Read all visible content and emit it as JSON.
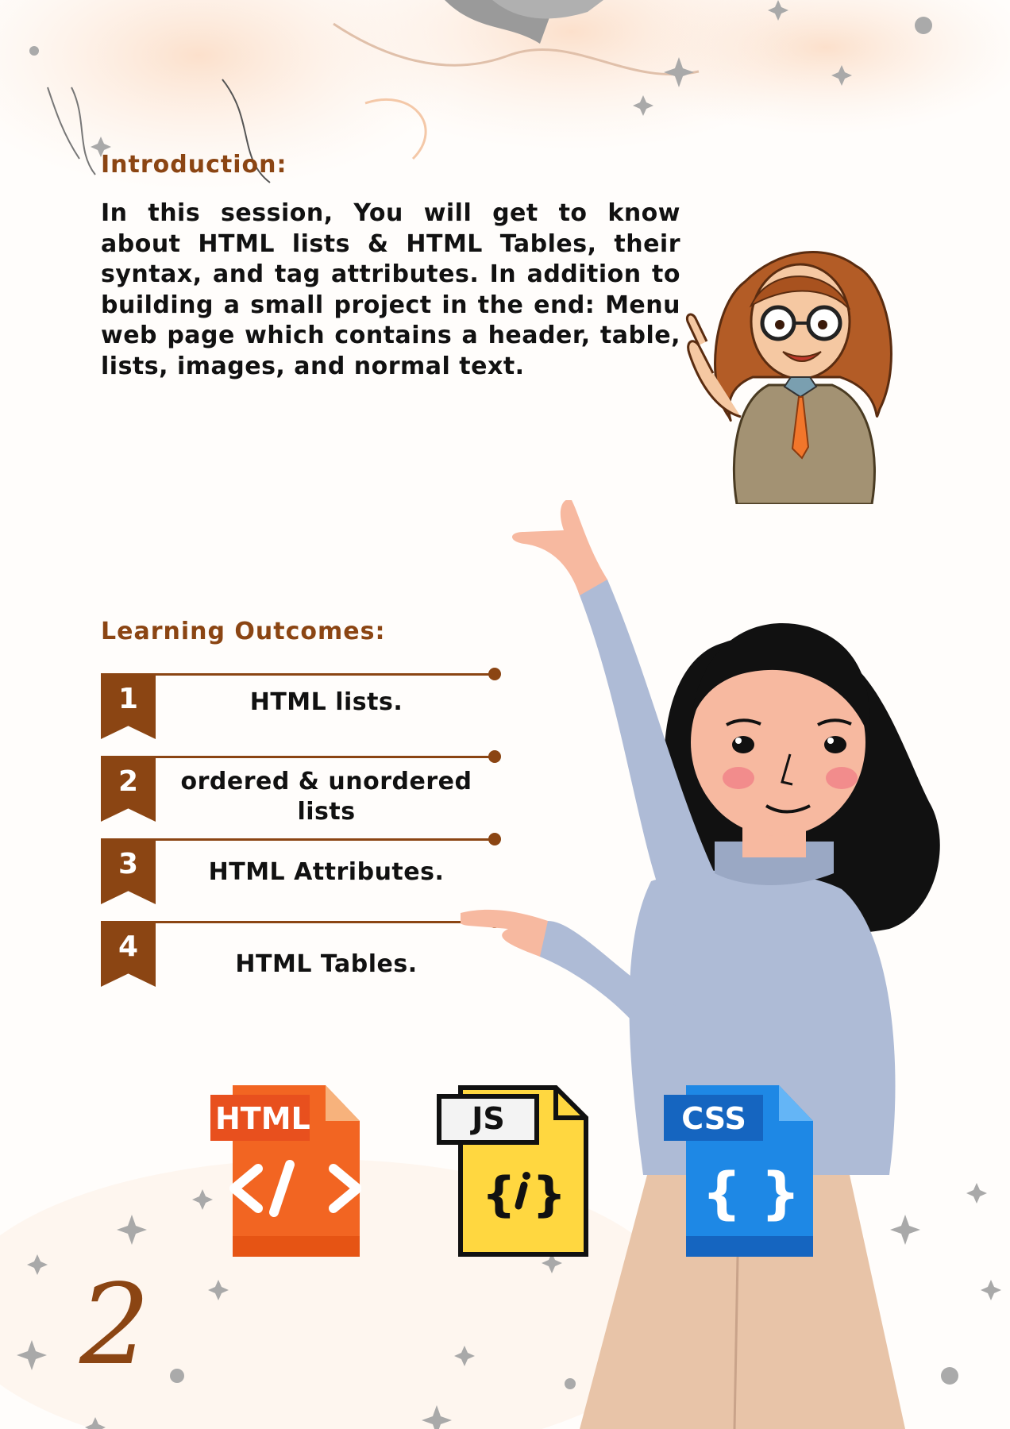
{
  "introduction": {
    "title": "Introduction:",
    "text": "In this session, You will get to know about HTML lists & HTML Tables, their syntax, and tag attributes. In addition to building a small project in the end: Menu web page which contains a header, table, lists, images, and normal text."
  },
  "learning_outcomes": {
    "title": "Learning Outcomes:",
    "items": [
      {
        "number": "1",
        "label": "HTML lists."
      },
      {
        "number": "2",
        "label": "ordered  & unordered lists"
      },
      {
        "number": "3",
        "label": "HTML Attributes."
      },
      {
        "number": "4",
        "label": "HTML Tables."
      }
    ]
  },
  "file_icons": {
    "html_label": "HTML",
    "js_label": "JS",
    "css_label": "CSS"
  },
  "page_number": "2",
  "colors": {
    "accent_brown": "#8b4513",
    "html_orange": "#f26522",
    "js_yellow": "#ffd740",
    "css_blue": "#1e88e5"
  },
  "icons": [
    "teacher-illustration",
    "presenter-illustration",
    "html-file-icon",
    "js-file-icon",
    "css-file-icon",
    "sparkle-icon"
  ]
}
